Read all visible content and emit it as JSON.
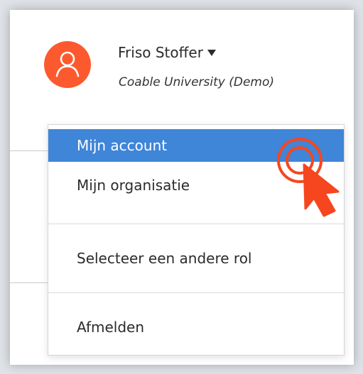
{
  "user": {
    "name": "Friso Stoffer",
    "organization": "Coable University (Demo)",
    "avatar_icon": "user-icon",
    "avatar_color": "#fc5a2e"
  },
  "menu": {
    "items": [
      {
        "label": "Mijn account",
        "active": true
      },
      {
        "label": "Mijn organisatie",
        "active": false
      },
      {
        "label": "Selecteer een andere rol",
        "active": false
      },
      {
        "label": "Afmelden",
        "active": false
      }
    ],
    "active_color": "#3f85d8"
  },
  "cursor": {
    "icon": "click-pointer-icon",
    "color": "#f6461f"
  }
}
